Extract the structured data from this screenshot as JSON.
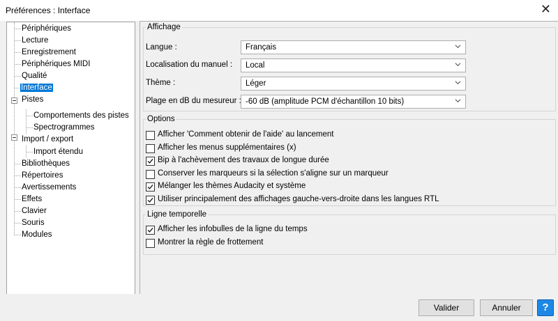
{
  "window": {
    "title": "Préférences : Interface",
    "close_glyph": "✕"
  },
  "tree": {
    "items": [
      {
        "label": "Périphériques"
      },
      {
        "label": "Lecture"
      },
      {
        "label": "Enregistrement"
      },
      {
        "label": "Périphériques MIDI"
      },
      {
        "label": "Qualité"
      },
      {
        "label": "Interface",
        "selected": true
      },
      {
        "label": "Pistes",
        "expanded": true
      },
      {
        "label": "Comportements des pistes"
      },
      {
        "label": "Spectrogrammes"
      },
      {
        "label": "Import / export",
        "expanded": true
      },
      {
        "label": "Import étendu"
      },
      {
        "label": "Bibliothèques"
      },
      {
        "label": "Répertoires"
      },
      {
        "label": "Avertissements"
      },
      {
        "label": "Effets"
      },
      {
        "label": "Clavier"
      },
      {
        "label": "Souris"
      },
      {
        "label": "Modules"
      }
    ]
  },
  "display": {
    "legend": "Affichage",
    "language": {
      "label": "Langue :",
      "value": "Français"
    },
    "manual": {
      "label": "Localisation du manuel :",
      "value": "Local"
    },
    "theme": {
      "label": "Thème :",
      "value": "Léger"
    },
    "meter": {
      "label": "Plage en dB du mesureur :",
      "value": "-60 dB (amplitude PCM d'échantillon 10 bits)"
    }
  },
  "options": {
    "legend": "Options",
    "items": [
      {
        "label": "Afficher 'Comment obtenir de l'aide' au lancement",
        "checked": false
      },
      {
        "label": "Afficher les menus supplémentaires (x)",
        "checked": false
      },
      {
        "label": "Bip à l'achèvement des travaux de longue durée",
        "checked": true
      },
      {
        "label": "Conserver les marqueurs si la sélection s'aligne sur un marqueur",
        "checked": false
      },
      {
        "label": "Mélanger les thèmes Audacity et système",
        "checked": true
      },
      {
        "label": "Utiliser principalement des affichages gauche-vers-droite dans les langues RTL",
        "checked": true
      }
    ]
  },
  "timeline": {
    "legend": "Ligne temporelle",
    "items": [
      {
        "label": "Afficher les infobulles de la ligne du temps",
        "checked": true
      },
      {
        "label": "Montrer la règle de frottement",
        "checked": false
      }
    ]
  },
  "buttons": {
    "ok": "Valider",
    "cancel": "Annuler",
    "help": "?"
  },
  "icons": {
    "dropdown": "chevron-down-icon",
    "check": "checkmark-icon",
    "help": "help-icon",
    "close": "close-icon"
  },
  "colors": {
    "selection": "#0078d7",
    "help": "#1e88e5"
  }
}
